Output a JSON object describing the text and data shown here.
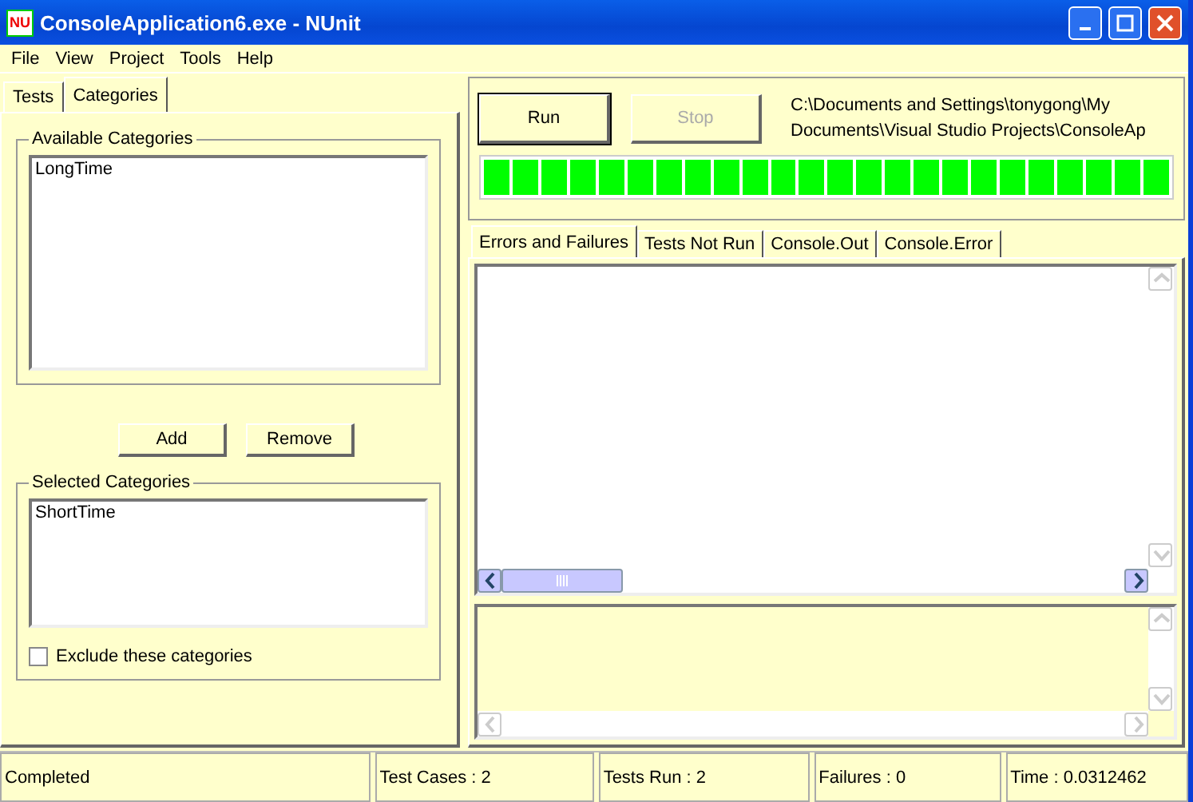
{
  "window": {
    "title": "ConsoleApplication6.exe - NUnit",
    "icon_text": "NU"
  },
  "menu": [
    "File",
    "View",
    "Project",
    "Tools",
    "Help"
  ],
  "left_tabs": [
    {
      "label": "Tests",
      "selected": false
    },
    {
      "label": "Categories",
      "selected": true
    }
  ],
  "available_categories": {
    "title": "Available Categories",
    "items": [
      "LongTime"
    ]
  },
  "buttons": [
    {
      "label": "Add"
    },
    {
      "label": "Remove"
    }
  ],
  "selected_categories": {
    "title": "Selected Categories",
    "items": [
      "ShortTime"
    ]
  },
  "exclude": {
    "label": "Exclude these categories",
    "checked": false
  },
  "run_button": {
    "label": "Run",
    "disabled": false
  },
  "stop_button": {
    "label": "Stop",
    "disabled": true
  },
  "path": "C:\\Documents and Settings\\tonygong\\My Documents\\Visual  Studio Projects\\ConsoleAp",
  "progress": {
    "level": 1
  },
  "result_tabs": [
    {
      "label": "Errors and Failures",
      "selected": true
    },
    {
      "label": "Tests Not Run",
      "selected": false
    },
    {
      "label": "Console.Out",
      "selected": false
    },
    {
      "label": "Console.Error",
      "selected": false
    }
  ],
  "status_bar": [
    "Completed",
    "Test Cases : 2",
    "Tests Run : 2",
    "Failures : 0",
    "Time : 0.0312462"
  ]
}
